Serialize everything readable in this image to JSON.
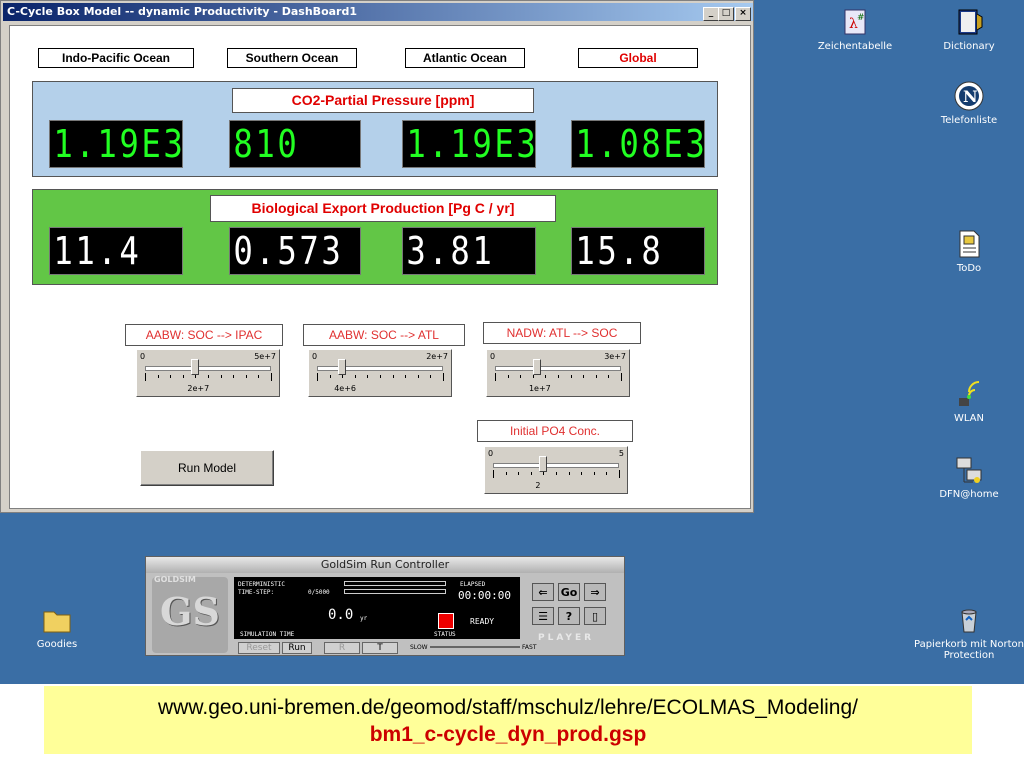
{
  "window": {
    "title": "C-Cycle Box Model -- dynamic Productivity - DashBoard1",
    "buttons": {
      "minimize": "_",
      "maximize": "□",
      "close": "×"
    }
  },
  "oceans": [
    "Indo-Pacific Ocean",
    "Southern Ocean",
    "Atlantic Ocean",
    "Global"
  ],
  "co2_panel": {
    "title": "CO2-Partial Pressure [ppm]",
    "values": [
      "1.19E3",
      "810",
      "1.19E3",
      "1.08E3"
    ],
    "bg": "#b4d0ea",
    "digit_color": "#22ff22"
  },
  "bio_panel": {
    "title": "Biological Export Production  [Pg C / yr]",
    "values": [
      "11.4",
      "0.573",
      "3.81",
      "15.8"
    ],
    "bg": "#62c646",
    "digit_color": "#ffffff"
  },
  "sliders": [
    {
      "label": "AABW: SOC --> IPAC",
      "min": "0",
      "max": "5e+7",
      "value": "2e+7",
      "fraction": 0.4
    },
    {
      "label": "AABW: SOC --> ATL",
      "min": "0",
      "max": "2e+7",
      "value": "4e+6",
      "fraction": 0.2
    },
    {
      "label": "NADW: ATL --> SOC",
      "min": "0",
      "max": "3e+7",
      "value": "1e+7",
      "fraction": 0.333
    },
    {
      "label": "Initial PO4 Conc.",
      "min": "0",
      "max": "5",
      "value": "2",
      "fraction": 0.4
    }
  ],
  "run_button": "Run Model",
  "desktop_icons": [
    {
      "label": "Zeichentabelle",
      "icon": "character-map-icon"
    },
    {
      "label": "Dictionary",
      "icon": "dictionary-icon"
    },
    {
      "label": "Telefonliste",
      "icon": "netscape-icon"
    },
    {
      "label": "ToDo",
      "icon": "document-icon"
    },
    {
      "label": "WLAN",
      "icon": "wireless-icon"
    },
    {
      "label": "DFN@home",
      "icon": "network-icon"
    },
    {
      "label": "Goodies",
      "icon": "folder-icon"
    },
    {
      "label": "Papierkorb mit Norton Protection",
      "icon": "recycle-bin-icon"
    }
  ],
  "goldsim": {
    "title": "GoldSim Run Controller",
    "logo_text": "GOLDSIM",
    "mode": "DETERMINISTIC",
    "timestep_label": "TIME-STEP:",
    "timestep_value": "0/5000",
    "elapsed_label": "ELAPSED",
    "elapsed_value": "00:00:00",
    "sim_time_value": "0.0",
    "sim_time_unit": "yr",
    "sim_time_label": "SIMULATION TIME",
    "status_label": "STATUS",
    "status_value": "READY",
    "buttons": [
      "Reset",
      "Run",
      "R",
      "T"
    ],
    "speed_slow": "SLOW",
    "speed_fast": "FAST",
    "go": "Go",
    "help": "?",
    "player": "PLAYER"
  },
  "banner": {
    "url": "www.geo.uni-bremen.de/geomod/staff/mschulz/lehre/ECOLMAS_Modeling/",
    "file": "bm1_c-cycle_dyn_prod.gsp",
    "file_color": "#cc0000"
  }
}
